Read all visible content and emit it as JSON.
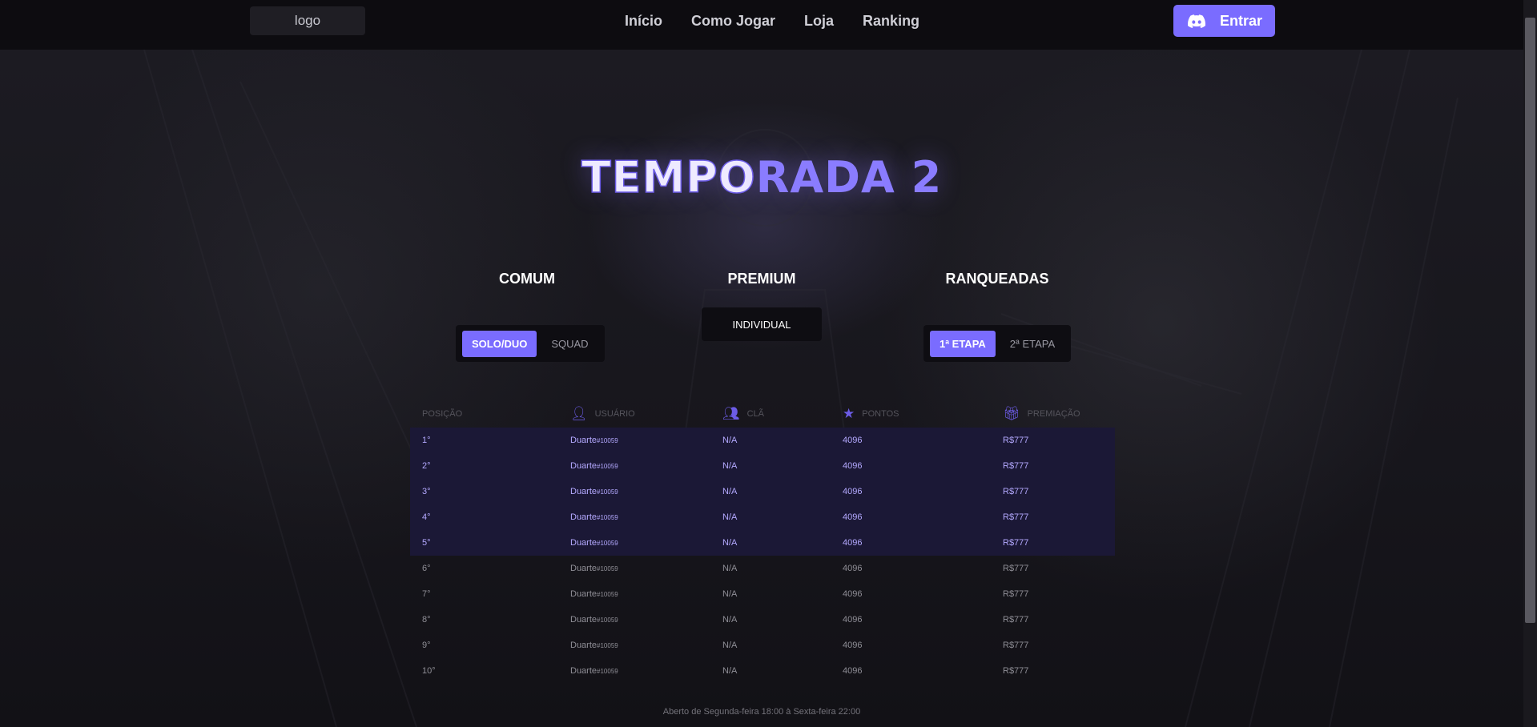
{
  "header": {
    "logo": "logo",
    "nav": [
      "Início",
      "Como Jogar",
      "Loja",
      "Ranking"
    ],
    "login_label": "Entrar"
  },
  "hero": {
    "title_part1": "TEMPO",
    "title_part2": "RADA 2"
  },
  "categories": {
    "comum": {
      "label": "COMUM",
      "options": [
        "SOLO/DUO",
        "SQUAD"
      ],
      "selected": "SOLO/DUO"
    },
    "premium": {
      "label": "PREMIUM",
      "options": [
        "INDIVIDUAL"
      ]
    },
    "ranqueadas": {
      "label": "RANQUEADAS",
      "options": [
        "1ª ETAPA",
        "2ª ETAPA"
      ],
      "selected": "1ª ETAPA"
    }
  },
  "table": {
    "headers": [
      "POSIÇÃO",
      "USUÁRIO",
      "CLÃ",
      "PONTOS",
      "PREMIAÇÃO"
    ],
    "rows": [
      {
        "pos": "1°",
        "user": "Duarte",
        "tag": "#10059",
        "clan": "N/A",
        "points": "4096",
        "prize": "R$777"
      },
      {
        "pos": "2°",
        "user": "Duarte",
        "tag": "#10059",
        "clan": "N/A",
        "points": "4096",
        "prize": "R$777"
      },
      {
        "pos": "3°",
        "user": "Duarte",
        "tag": "#10059",
        "clan": "N/A",
        "points": "4096",
        "prize": "R$777"
      },
      {
        "pos": "4°",
        "user": "Duarte",
        "tag": "#10059",
        "clan": "N/A",
        "points": "4096",
        "prize": "R$777"
      },
      {
        "pos": "5°",
        "user": "Duarte",
        "tag": "#10059",
        "clan": "N/A",
        "points": "4096",
        "prize": "R$777"
      },
      {
        "pos": "6°",
        "user": "Duarte",
        "tag": "#10059",
        "clan": "N/A",
        "points": "4096",
        "prize": "R$777"
      },
      {
        "pos": "7°",
        "user": "Duarte",
        "tag": "#10059",
        "clan": "N/A",
        "points": "4096",
        "prize": "R$777"
      },
      {
        "pos": "8°",
        "user": "Duarte",
        "tag": "#10059",
        "clan": "N/A",
        "points": "4096",
        "prize": "R$777"
      },
      {
        "pos": "9°",
        "user": "Duarte",
        "tag": "#10059",
        "clan": "N/A",
        "points": "4096",
        "prize": "R$777"
      },
      {
        "pos": "10°",
        "user": "Duarte",
        "tag": "#10059",
        "clan": "N/A",
        "points": "4096",
        "prize": "R$777"
      }
    ]
  },
  "footer_note": "Aberto de Segunda-feira 18:00 à Sexta-feira 22:00",
  "colors": {
    "accent": "#7a6cff",
    "highlight_row": "#1b1836"
  }
}
